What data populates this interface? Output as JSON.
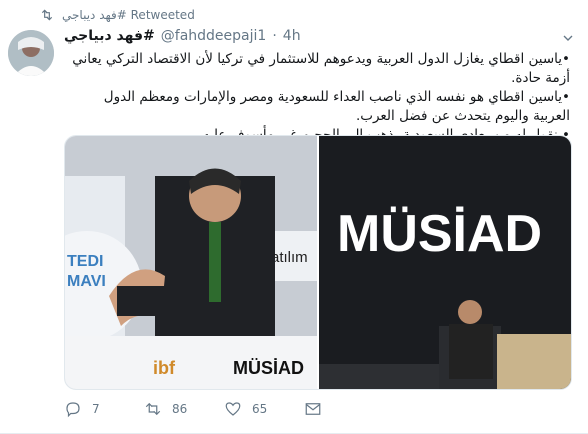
{
  "retweet": {
    "icon": "retweet-icon",
    "label": "فهد ديباجي# Retweeted"
  },
  "author": {
    "display_name": "فهد دبياجي#",
    "handle": "@fahddeepaji1",
    "separator": "·",
    "time": "4h"
  },
  "tweet": {
    "lines": [
      "•ياسين اقطاي يغازل الدول العربية ويدعوهم للاستثمار في تركيا لأن الاقتصاد التركي يعاني أزمة حادة.",
      "•ياسين اقطاي هو نفسه الذي ناصب العداء للسعودية ومصر والإمارات ومعظم الدول العربية واليوم يتحدث عن فضل العرب.",
      "• نقول له من يعادي السعودية يذهب إلى الجحيم غير مأسوف عليه."
    ]
  },
  "media": {
    "left_photo_texts": [
      "TEDI",
      "MAVI",
      "Katılım",
      "ibf",
      "MÜSİAD"
    ],
    "right_photo_texts": [
      "MÜSİAD"
    ]
  },
  "actions": {
    "reply": {
      "icon": "reply-icon",
      "count": "7"
    },
    "retweet": {
      "icon": "retweet-icon",
      "count": "86"
    },
    "like": {
      "icon": "heart-icon",
      "count": "65"
    },
    "message": {
      "icon": "message-icon"
    }
  },
  "colors": {
    "muted": "#657786",
    "text": "#14171a",
    "border": "#e6ecf0"
  }
}
